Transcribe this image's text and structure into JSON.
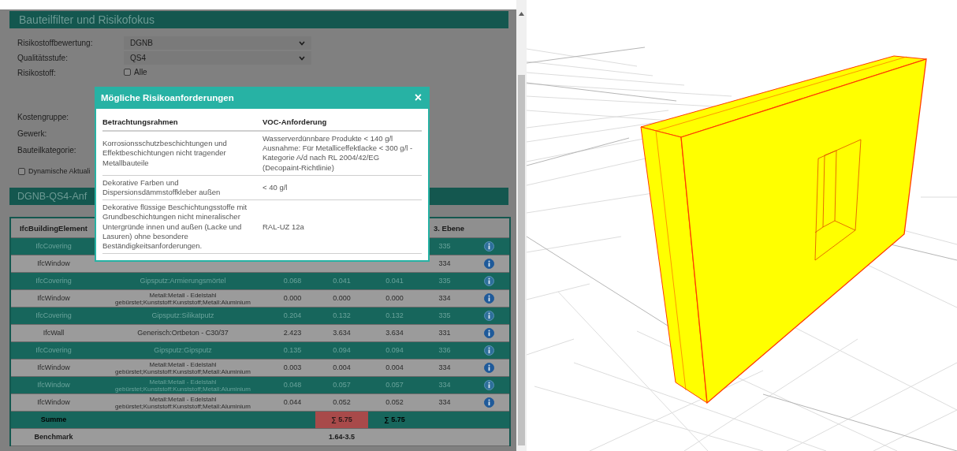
{
  "filter_panel": {
    "title": "Bauteilfilter und Risikofokus",
    "fields": [
      {
        "kind": "select",
        "label": "Risikostoffbewertung:",
        "value": "DGNB"
      },
      {
        "kind": "select",
        "label": "Qualitätsstufe:",
        "value": "QS4"
      },
      {
        "kind": "checkbox",
        "label": "Risikostoff:",
        "option": "Alle",
        "checked": false
      },
      {
        "kind": "label",
        "label": "Kostengruppe:"
      },
      {
        "kind": "label",
        "label": "Gewerk:"
      },
      {
        "kind": "label",
        "label": "Bauteilkategorie:"
      }
    ],
    "dynamic_update": {
      "label": "Dynamische Aktuali",
      "checked": false
    }
  },
  "results": {
    "title": "DGNB-QS4-Anf",
    "header": {
      "column_1": "IfcBuildingElement",
      "column_6": "3. Ebene"
    },
    "rows": [
      {
        "kind": "data",
        "element": "IfcCovering",
        "level3": "335"
      },
      {
        "kind": "data",
        "element": "IfcWindow",
        "level3": "334"
      },
      {
        "kind": "data",
        "element": "IfcCovering",
        "material": [
          "Gipsputz:Armierungsmörtel"
        ],
        "values": [
          "0.068",
          "0.041",
          "0.041"
        ],
        "level3": "335"
      },
      {
        "kind": "data",
        "element": "IfcWindow",
        "material": [
          "Metall:Metall - Edelstahl",
          "gebürstet;Kunststoff:Kunststoff;Metall:Aluminium"
        ],
        "values": [
          "0.000",
          "0.000",
          "0.000"
        ],
        "level3": "334"
      },
      {
        "kind": "data",
        "element": "IfcCovering",
        "material": [
          "Gipsputz:Silikatputz"
        ],
        "values": [
          "0.204",
          "0.132",
          "0.132"
        ],
        "level3": "335"
      },
      {
        "kind": "data",
        "element": "IfcWall",
        "material": [
          "Generisch:Ortbeton - C30/37"
        ],
        "values": [
          "2.423",
          "3.634",
          "3.634"
        ],
        "level3": "331"
      },
      {
        "kind": "data",
        "element": "IfcCovering",
        "material": [
          "Gipsputz:Gipsputz"
        ],
        "values": [
          "0.135",
          "0.094",
          "0.094"
        ],
        "level3": "336"
      },
      {
        "kind": "data",
        "element": "IfcWindow",
        "material": [
          "Metall:Metall - Edelstahl",
          "gebürstet;Kunststoff:Kunststoff;Metall:Aluminium"
        ],
        "values": [
          "0.003",
          "0.004",
          "0.004"
        ],
        "level3": "334"
      },
      {
        "kind": "data",
        "element": "IfcWindow",
        "material": [
          "Metall:Metall - Edelstahl",
          "gebürstet;Kunststoff:Kunststoff;Metall:Aluminium"
        ],
        "values": [
          "0.048",
          "0.057",
          "0.057"
        ],
        "level3": "334"
      },
      {
        "kind": "data",
        "element": "IfcWindow",
        "material": [
          "Metall:Metall - Edelstahl",
          "gebürstet;Kunststoff:Kunststoff;Metall:Aluminium"
        ],
        "values": [
          "0.044",
          "0.052",
          "0.052"
        ],
        "level3": "334"
      },
      {
        "kind": "sum",
        "element": "Summe",
        "totals": [
          {
            "text": "∑ 5.75",
            "alert": true
          },
          {
            "text": "∑ 5.75",
            "alert": false
          }
        ]
      },
      {
        "kind": "benchmark",
        "element": "Benchmark",
        "range": "1.64-3.5"
      }
    ]
  },
  "modal": {
    "title": "Mögliche Risikoanforderungen",
    "close": "×",
    "columns": [
      "Betrachtungsrahmen",
      "VOC-Anforderung"
    ],
    "rows": [
      {
        "scope": "Korrosionsschutzbeschichtungen und Effektbeschichtungen nicht tragender Metallbauteile",
        "requirement": "Wasserverdünnbare Produkte < 140 g/l\nAusnahme: Für Metalliceffektlacke < 300 g/l - Kategorie A/d nach RL 2004/42/EG (Decopaint-Richtlinie)"
      },
      {
        "scope": "Dekorative Farben und Dispersionsdämmstoffkleber außen",
        "requirement": "< 40 g/l"
      },
      {
        "scope": "Dekorative flüssige Beschichtungsstoffe mit Grundbeschichtungen nicht mineralischer Untergründe innen und außen (Lacke und Lasuren) ohne besondere Beständigkeitsanforderungen.",
        "requirement": "RAL-UZ 12a"
      }
    ]
  }
}
